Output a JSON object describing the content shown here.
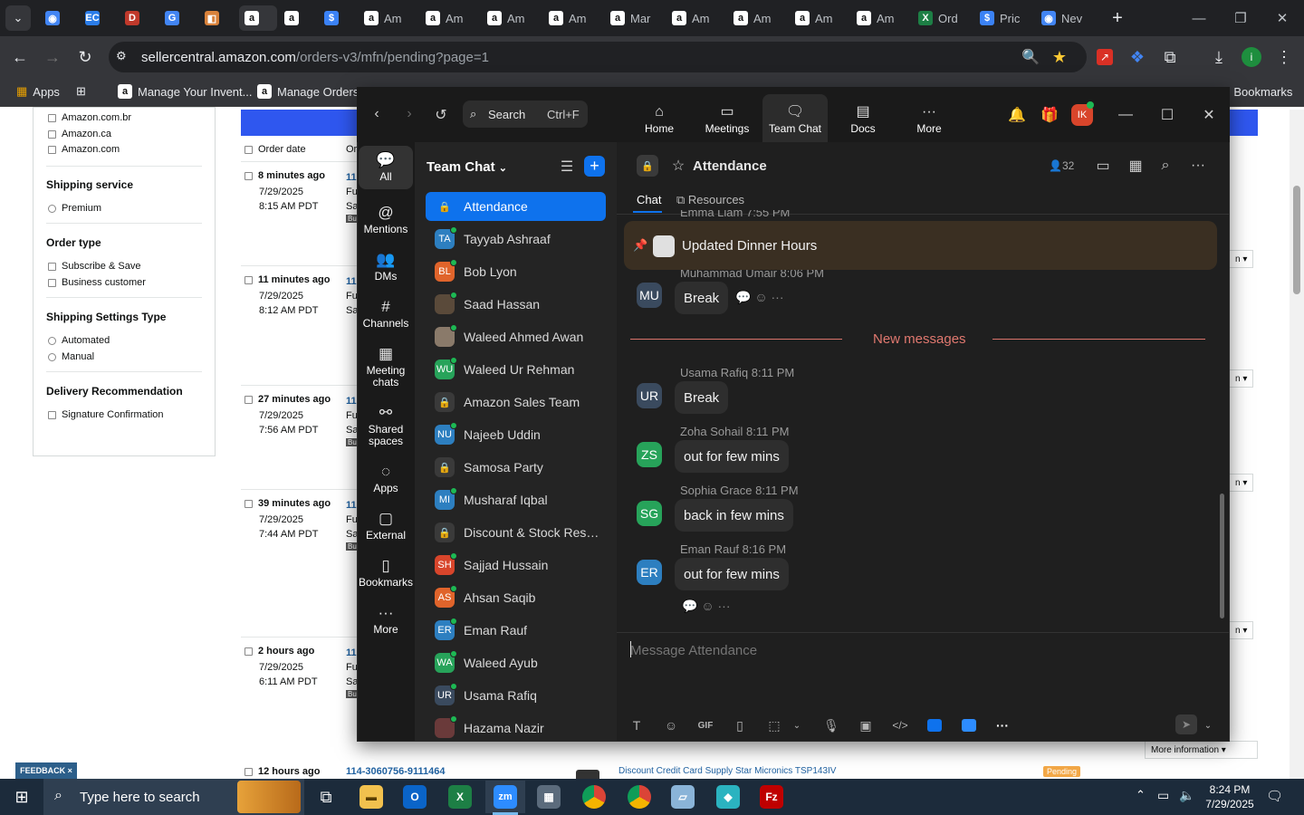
{
  "browser": {
    "tabs": [
      {
        "label": "",
        "icon": "chrome-icon"
      },
      {
        "label": "",
        "icon": "ec-icon"
      },
      {
        "label": "",
        "icon": "dwh-icon"
      },
      {
        "label": "",
        "icon": "google-icon"
      },
      {
        "label": "",
        "icon": "box-icon"
      },
      {
        "label": "",
        "icon": "amazon-icon"
      },
      {
        "label": "",
        "icon": "amazon-icon"
      },
      {
        "label": "",
        "icon": "dollar-icon"
      },
      {
        "label": "Am",
        "icon": "amazon-icon"
      },
      {
        "label": "Am",
        "icon": "amazon-icon"
      },
      {
        "label": "Am",
        "icon": "amazon-icon"
      },
      {
        "label": "Am",
        "icon": "amazon-icon"
      },
      {
        "label": "Mar",
        "icon": "amazon-icon"
      },
      {
        "label": "Am",
        "icon": "amazon-icon"
      },
      {
        "label": "Am",
        "icon": "amazon-icon"
      },
      {
        "label": "Am",
        "icon": "amazon-icon"
      },
      {
        "label": "Am",
        "icon": "amazon-icon"
      },
      {
        "label": "Ord",
        "icon": "excel-icon"
      },
      {
        "label": "Pric",
        "icon": "dollar-icon"
      },
      {
        "label": "Nev",
        "icon": "chrome-icon"
      }
    ],
    "url_host": "sellercentral.amazon.com",
    "url_path": "/orders-v3/mfn/pending?page=1",
    "bookmarks": {
      "apps": "Apps",
      "item1": "Manage Your Invent...",
      "item2": "Manage Orders",
      "all": "All Bookmarks"
    }
  },
  "seller": {
    "filters": {
      "marketplaces": [
        "Amazon.com.br",
        "Amazon.ca",
        "Amazon.com"
      ],
      "shipping_service_title": "Shipping service",
      "shipping_service": [
        "Premium"
      ],
      "order_type_title": "Order type",
      "order_type": [
        "Subscribe & Save",
        "Business customer"
      ],
      "shipping_settings_title": "Shipping Settings Type",
      "shipping_settings": [
        "Automated",
        "Manual"
      ],
      "delivery_title": "Delivery Recommendation",
      "delivery": [
        "Signature Confirmation"
      ]
    },
    "col_order_date": "Order date",
    "col_or": "Or",
    "orders": [
      {
        "ago": "8 minutes ago",
        "date": "7/29/2025",
        "time": "8:15 AM PDT",
        "id": "11",
        "a": "Fu",
        "b": "Sa",
        "c": "Bu"
      },
      {
        "ago": "11 minutes ago",
        "date": "7/29/2025",
        "time": "8:12 AM PDT",
        "id": "11",
        "a": "Fu",
        "b": "Sa",
        "c": ""
      },
      {
        "ago": "27 minutes ago",
        "date": "7/29/2025",
        "time": "7:56 AM PDT",
        "id": "11",
        "a": "Fu",
        "b": "Sa",
        "c": "Bu"
      },
      {
        "ago": "39 minutes ago",
        "date": "7/29/2025",
        "time": "7:44 AM PDT",
        "id": "11",
        "a": "Fu",
        "b": "Sa",
        "c": "Bu"
      },
      {
        "ago": "2 hours ago",
        "date": "7/29/2025",
        "time": "6:11 AM PDT",
        "id": "11",
        "a": "Fu",
        "b": "Sa",
        "c": "Bu"
      }
    ],
    "last_row": {
      "ago": "12 hours ago",
      "id": "114-3060756-9111464",
      "product": "Discount Credit Card Supply Star Micronics TSP143IV",
      "status": "Pending"
    },
    "right_tags": [
      "n ▾",
      "n ▾",
      "n ▾",
      "n ▾"
    ],
    "more_info": "More information ▾",
    "feedback": "FEEDBACK ×"
  },
  "zoom": {
    "search": {
      "label": "Search",
      "shortcut": "Ctrl+F"
    },
    "top_nav": [
      {
        "label": "Home",
        "icon": "home-icon"
      },
      {
        "label": "Meetings",
        "icon": "video-icon"
      },
      {
        "label": "Team Chat",
        "icon": "chat-icon"
      },
      {
        "label": "Docs",
        "icon": "docs-icon"
      },
      {
        "label": "More",
        "icon": "more-icon"
      }
    ],
    "user_initials": "IK",
    "rail": [
      {
        "label": "All",
        "icon": "chat-bubble-icon"
      },
      {
        "label": "Mentions",
        "icon": "at-icon"
      },
      {
        "label": "DMs",
        "icon": "people-icon"
      },
      {
        "label": "Channels",
        "icon": "hash-icon"
      },
      {
        "label": "Meeting chats",
        "icon": "calendar-icon"
      },
      {
        "label": "Shared spaces",
        "icon": "share-icon"
      },
      {
        "label": "Apps",
        "icon": "apps-icon"
      },
      {
        "label": "External",
        "icon": "external-icon"
      },
      {
        "label": "Bookmarks",
        "icon": "bookmark-icon"
      },
      {
        "label": "More",
        "icon": "more-icon"
      }
    ],
    "list_title": "Team Chat",
    "chats": [
      {
        "name": "Attendance",
        "type": "lock"
      },
      {
        "name": "Tayyab Ashraaf",
        "initials": "TA",
        "color": "#2d7fc0"
      },
      {
        "name": "Bob Lyon",
        "initials": "BL",
        "color": "#e0642b"
      },
      {
        "name": "Saad Hassan",
        "initials": "",
        "color": "#5a4a3a"
      },
      {
        "name": "Waleed Ahmed Awan",
        "initials": "",
        "color": "#8a7a6a"
      },
      {
        "name": "Waleed Ur Rehman",
        "initials": "WU",
        "color": "#27a35a"
      },
      {
        "name": "Amazon Sales Team",
        "type": "lock"
      },
      {
        "name": "Najeeb Uddin",
        "initials": "NU",
        "color": "#2d7fc0"
      },
      {
        "name": "Samosa Party",
        "type": "lock"
      },
      {
        "name": "Musharaf Iqbal",
        "initials": "MI",
        "color": "#2d7fc0"
      },
      {
        "name": "Discount & Stock Reser...",
        "type": "lock"
      },
      {
        "name": "Sajjad Hussain",
        "initials": "SH",
        "color": "#d8452b"
      },
      {
        "name": "Ahsan Saqib",
        "initials": "AS",
        "color": "#e0642b"
      },
      {
        "name": "Eman Rauf",
        "initials": "ER",
        "color": "#2d7fc0"
      },
      {
        "name": "Waleed Ayub",
        "initials": "WA",
        "color": "#27a35a"
      },
      {
        "name": "Usama Rafiq",
        "initials": "UR",
        "color": "#3a4a5e"
      },
      {
        "name": "Hazama Nazir",
        "initials": "",
        "color": "#6a3a3a"
      }
    ],
    "channel": {
      "name": "Attendance",
      "members": "32",
      "tabs": {
        "chat": "Chat",
        "resources": "Resources"
      },
      "pinned": "Updated Dinner Hours",
      "top_cut_meta": "Emma Liam 7:55 PM",
      "new_messages": "New messages",
      "composer_placeholder": "Message Attendance"
    },
    "messages": [
      {
        "initials": "MU",
        "color": "#3a4a5e",
        "meta": "Muhammad Umair 8:06 PM",
        "text": "Break"
      },
      {
        "initials": "UR",
        "color": "#3a4a5e",
        "meta": "Usama Rafiq 8:11 PM",
        "text": "Break"
      },
      {
        "initials": "ZS",
        "color": "#27a35a",
        "meta": "Zoha Sohail 8:11 PM",
        "text": "out for few mins"
      },
      {
        "initials": "SG",
        "color": "#27a35a",
        "meta": "Sophia Grace 8:11 PM",
        "text": "back in few mins"
      },
      {
        "initials": "ER",
        "color": "#2d7fc0",
        "meta": "Eman Rauf 8:16 PM",
        "text": "out for few mins"
      }
    ]
  },
  "taskbar": {
    "search_placeholder": "Type here to search",
    "time": "8:24 PM",
    "date": "7/29/2025"
  }
}
